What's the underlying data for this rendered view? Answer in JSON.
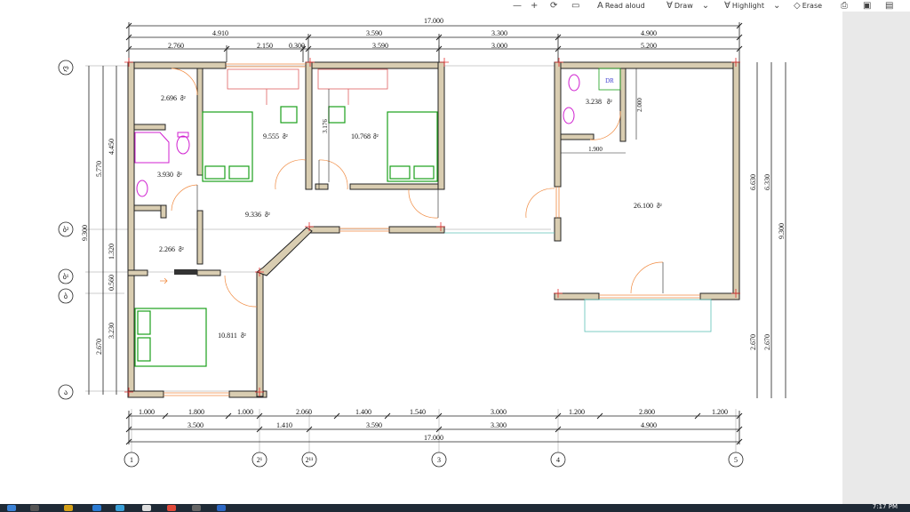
{
  "toolbar": {
    "read_aloud": "Read aloud",
    "draw": "Draw",
    "highlight": "Highlight",
    "erase": "Erase"
  },
  "taskbar": {
    "clock": "7:17 PM"
  },
  "plan": {
    "top_dims": {
      "overall": "17.000",
      "row2": [
        "4.910",
        "3.590",
        "3.300",
        "4.900"
      ],
      "row3": [
        "2.760",
        "2.150",
        "0.300",
        "3.590",
        "3.000",
        "5.200"
      ]
    },
    "bottom_dims": {
      "row1": [
        "1.000",
        "1.800",
        "1.000",
        "2.060",
        "1.400",
        "1.540",
        "3.000",
        "1.200",
        "2.800",
        "1.200"
      ],
      "row2": [
        "3.500",
        "1.410",
        "3.590",
        "3.300",
        "4.900"
      ],
      "overall": "17.000"
    },
    "left_dims": [
      "9.300",
      "5.770",
      "4.450",
      "1.320",
      "0.560",
      "3.230",
      "2.670"
    ],
    "right_dims": [
      "6.630",
      "6.330",
      "9.300",
      "2.670",
      "2.670"
    ],
    "axes_bottom": [
      "1",
      "2¹",
      "2¹¹",
      "3",
      "4",
      "5"
    ],
    "axes_left": [
      "ღ",
      "ბ²",
      "ბ¹",
      "ბ",
      "ა"
    ],
    "rooms": [
      {
        "area": "2.696",
        "unit": "მ²"
      },
      {
        "area": "9.555",
        "unit": "მ²"
      },
      {
        "area": "10.768",
        "unit": "მ²"
      },
      {
        "area": "3.930",
        "unit": "მ²"
      },
      {
        "area": "9.336",
        "unit": "მ²"
      },
      {
        "area": "2.266",
        "unit": "მ²"
      },
      {
        "area": "10.811",
        "unit": "მ²"
      },
      {
        "area": "3.238",
        "unit": "მ²"
      },
      {
        "area": "26.100",
        "unit": "მ²"
      }
    ],
    "inner_dims": [
      "3.176",
      "2.000",
      "1.900"
    ],
    "dr_label": "DR"
  }
}
